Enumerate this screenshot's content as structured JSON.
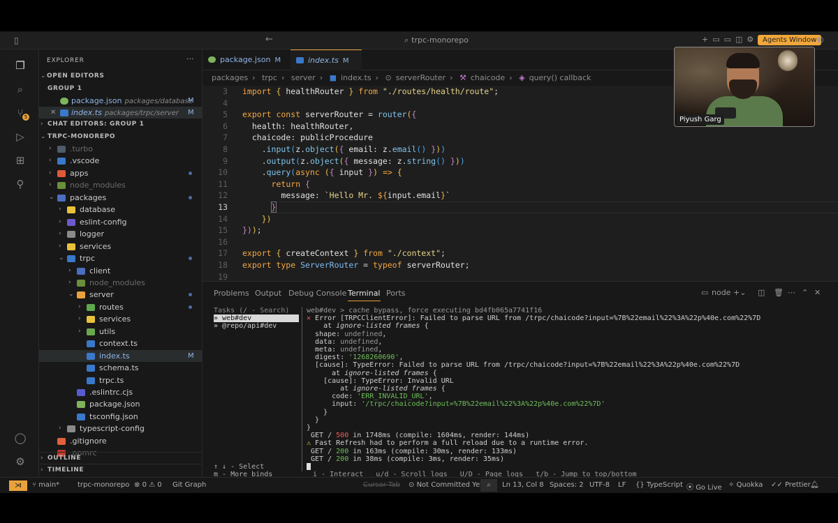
{
  "titlebar": {
    "search": "trpc-monorepo",
    "agents_button": "Agents Window"
  },
  "sidebar": {
    "title": "EXPLORER",
    "open_editors": "OPEN EDITORS",
    "group": "GROUP 1",
    "open_files": [
      {
        "name": "package.json",
        "path": "packages/database",
        "status": "M"
      },
      {
        "name": "index.ts",
        "path": "packages/trpc/server",
        "status": "M"
      }
    ],
    "chat_editors": "CHAT EDITORS: GROUP 1",
    "root": "TRPC-MONOREPO",
    "tree": [
      {
        "label": ".turbo"
      },
      {
        "label": ".vscode"
      },
      {
        "label": "apps"
      },
      {
        "label": "node_modules"
      },
      {
        "label": "packages"
      },
      {
        "label": "database"
      },
      {
        "label": "eslint-config"
      },
      {
        "label": "logger"
      },
      {
        "label": "services"
      },
      {
        "label": "trpc"
      },
      {
        "label": "client"
      },
      {
        "label": "node_modules"
      },
      {
        "label": "server"
      },
      {
        "label": "routes"
      },
      {
        "label": "services"
      },
      {
        "label": "utils"
      },
      {
        "label": "context.ts"
      },
      {
        "label": "index.ts",
        "status": "M"
      },
      {
        "label": "schema.ts"
      },
      {
        "label": "trpc.ts"
      },
      {
        "label": ".eslintrc.cjs"
      },
      {
        "label": "package.json"
      },
      {
        "label": "tsconfig.json"
      },
      {
        "label": "typescript-config"
      },
      {
        "label": ".gitignore"
      },
      {
        "label": ".npmrc"
      }
    ],
    "outline": "OUTLINE",
    "timeline": "TIMELINE"
  },
  "tabs": [
    {
      "label": "package.json",
      "status": "M"
    },
    {
      "label": "index.ts",
      "status": "M"
    }
  ],
  "breadcrumb": [
    "packages",
    "trpc",
    "server",
    "index.ts",
    "serverRouter",
    "chaicode",
    "query() callback"
  ],
  "code": {
    "line_numbers": [
      "3",
      "4",
      "5",
      "6",
      "7",
      "8",
      "9",
      "10",
      "11",
      "12",
      "13",
      "14",
      "15",
      "16",
      "17",
      "18",
      "19"
    ],
    "current_line": "13"
  },
  "panel": {
    "tabs": [
      "Problems",
      "Output",
      "Debug Console",
      "Terminal",
      "Ports"
    ],
    "active_tab": "Terminal",
    "terminal_name": "node",
    "tasks_header": "Tasks (/ - Search)",
    "tasks": [
      "» web#dev",
      "» @repo/api#dev"
    ],
    "tasks_footer": [
      "↑ ↓ - Select",
      "m - More binds"
    ],
    "terminal_footer": "i - Interact   u/d - Scroll logs   U/D - Page logs   t/b - Jump to top/bottom"
  },
  "statusbar": {
    "branch": "main*",
    "repo": "trpc-monorepo",
    "errors": "0",
    "warnings": "0",
    "git_graph": "Git Graph",
    "cursor_tab": "Cursor Tab",
    "not_committed": "Not Committed Yet",
    "position": "Ln 13, Col 8",
    "spaces": "Spaces: 2",
    "encoding": "UTF-8",
    "eol": "LF",
    "language": "TypeScript",
    "go_live": "Go Live",
    "quokka": "Quokka",
    "prettier": "Prettier"
  },
  "webcam": {
    "name": "Piyush Garg"
  },
  "colors": {
    "accent": "#e9a23b",
    "background": "#181818",
    "editor": "#1e1e1e"
  }
}
